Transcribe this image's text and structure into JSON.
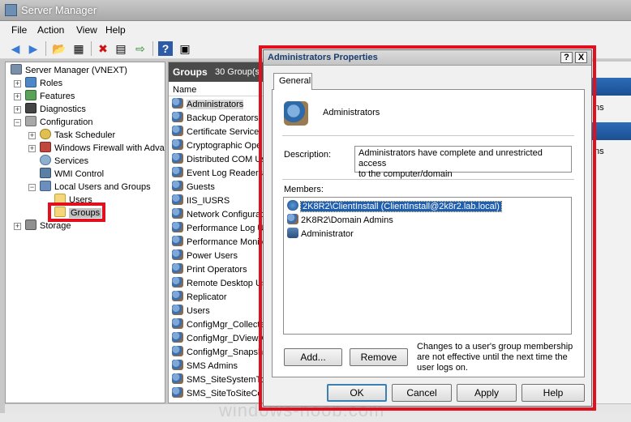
{
  "window": {
    "title": "Server Manager"
  },
  "menu": {
    "file": "File",
    "action": "Action",
    "view": "View",
    "help": "Help"
  },
  "tree": {
    "root": "Server Manager (VNEXT)",
    "roles": "Roles",
    "features": "Features",
    "diagnostics": "Diagnostics",
    "configuration": "Configuration",
    "task_scheduler": "Task Scheduler",
    "firewall": "Windows Firewall with Adva",
    "services": "Services",
    "wmi": "WMI Control",
    "local_users_groups": "Local Users and Groups",
    "users": "Users",
    "groups": "Groups",
    "storage": "Storage"
  },
  "groups_pane": {
    "title": "Groups",
    "count": "30 Group(s)",
    "column_name": "Name",
    "rows": [
      "Administrators",
      "Backup Operators",
      "Certificate Service",
      "Cryptographic Ope",
      "Distributed COM Us",
      "Event Log Readers",
      "Guests",
      "IIS_IUSRS",
      "Network Configurat",
      "Performance Log U",
      "Performance Monito",
      "Power Users",
      "Print Operators",
      "Remote Desktop Us",
      "Replicator",
      "Users",
      "ConfigMgr_Collecte",
      "ConfigMgr_DViewA",
      "ConfigMgr_Snapsho",
      "SMS Admins",
      "SMS_SiteSystemTo",
      "SMS_SiteToSiteCon"
    ]
  },
  "actions_pane": {
    "item1": "ns",
    "item2": "rs",
    "item3": "ns"
  },
  "dialog": {
    "title": "Administrators Properties",
    "help_btn": "?",
    "close_btn": "X",
    "tab_general": "General",
    "group_name": "Administrators",
    "description_label": "Description:",
    "description_line1": "Administrators have complete and unrestricted access",
    "description_line2": "to the computer/domain",
    "members_label": "Members:",
    "members": [
      "2K8R2\\ClientInstall (ClientInstall@2k8r2.lab.local)",
      "2K8R2\\Domain Admins",
      "Administrator"
    ],
    "add_button": "Add...",
    "remove_button": "Remove",
    "note_line1": "Changes to a user's group membership",
    "note_line2": "are not effective until the next time the",
    "note_line3": "user logs on.",
    "ok_button": "OK",
    "cancel_button": "Cancel",
    "apply_button": "Apply",
    "help_button": "Help"
  },
  "watermark": "windows-noob.com",
  "colors": {
    "highlight_red": "#e0101e",
    "selection_blue": "#1f5fb0"
  }
}
